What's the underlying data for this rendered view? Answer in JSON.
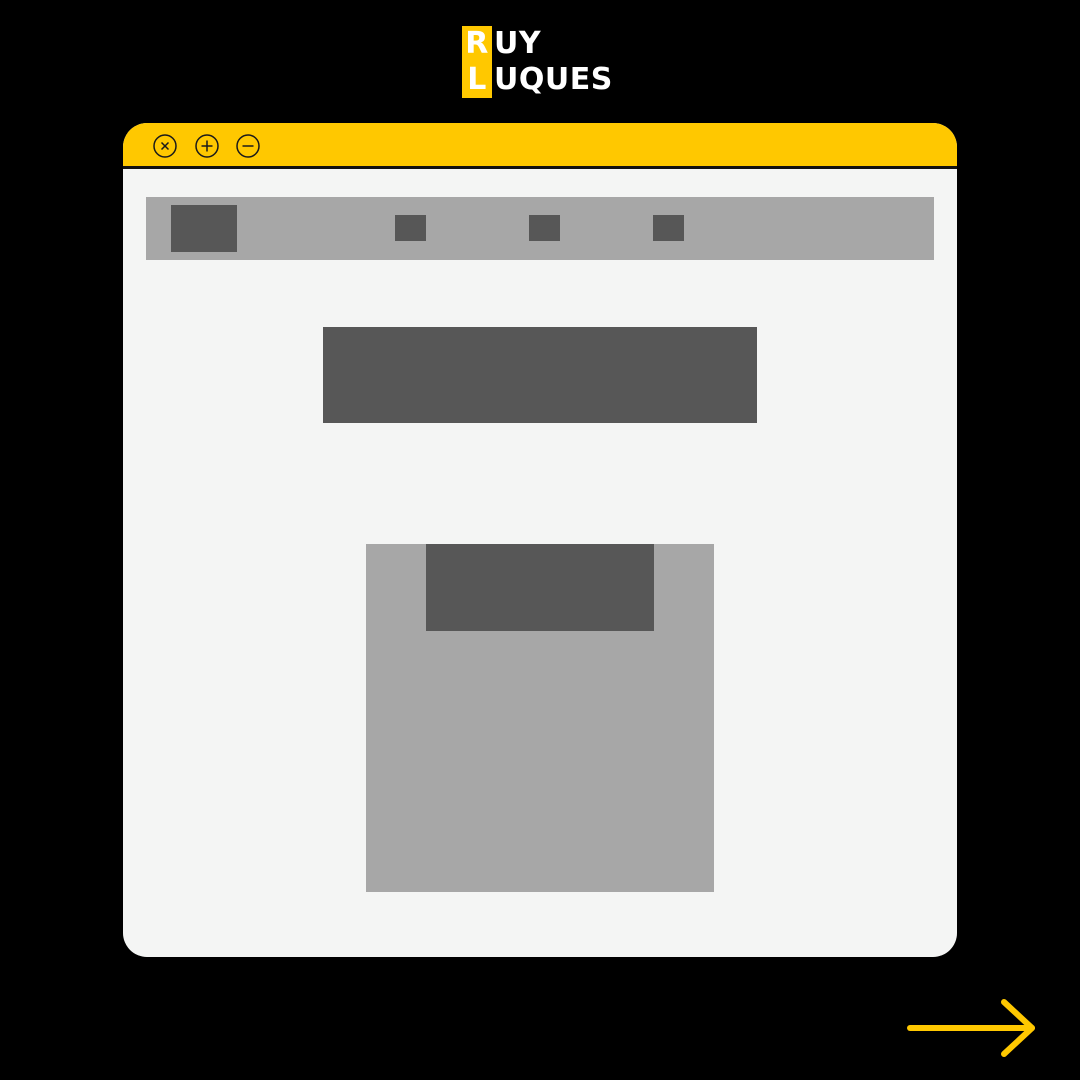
{
  "brand": {
    "line1_initial": "R",
    "line1_rest": "UY",
    "line2_initial": "L",
    "line2_rest": "UQUES"
  },
  "colors": {
    "background": "#000000",
    "accent": "#FFC800",
    "window_bg": "#F4F5F4",
    "placeholder_light": "#A7A7A7",
    "placeholder_dark": "#575757"
  },
  "window": {
    "controls": [
      {
        "icon": "close-icon"
      },
      {
        "icon": "maximize-icon"
      },
      {
        "icon": "minimize-icon"
      }
    ]
  },
  "navigation": {
    "next_icon": "arrow-right-icon"
  }
}
